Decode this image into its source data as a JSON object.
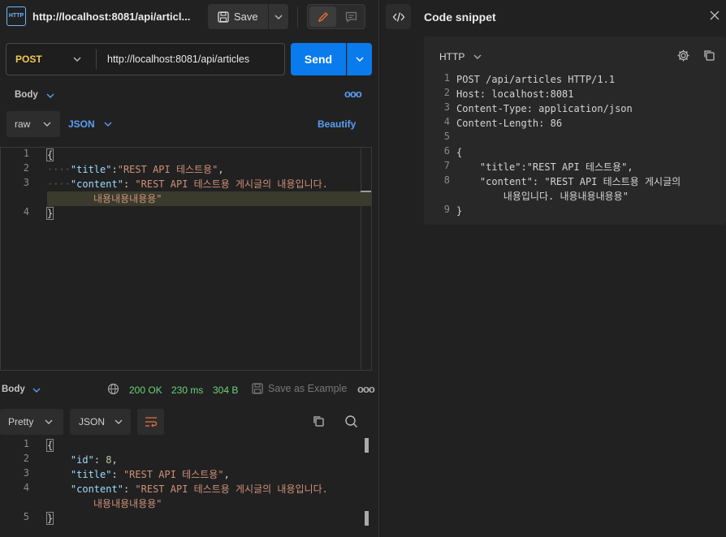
{
  "request": {
    "tab_icon_label": "HTTP",
    "title": "http://localhost:8081/api/articl...",
    "save_label": "Save",
    "method": "POST",
    "url": "http://localhost:8081/api/articles",
    "send_label": "Send"
  },
  "body_panel": {
    "section_label": "Body",
    "mode": "raw",
    "language": "JSON",
    "beautify_label": "Beautify",
    "line_numbers": [
      "1",
      "2",
      "3",
      "4"
    ],
    "lines": {
      "l1": "{",
      "l2_key": "\"title\"",
      "l2_sep": ":",
      "l2_val": "\"REST API 테스트용\"",
      "l2_end": ",",
      "l3_key": "\"content\"",
      "l3_sep": ": ",
      "l3_val_a": "\"REST API 테스트용 게시글의 내용입니다.",
      "l3_val_b": "내용내용내용용\"",
      "l4": "}"
    }
  },
  "response": {
    "section_label": "Body",
    "status": "200 OK",
    "time": "230 ms",
    "size": "304 B",
    "save_example_label": "Save as Example",
    "view_mode": "Pretty",
    "language": "JSON",
    "line_numbers": [
      "1",
      "2",
      "3",
      "4",
      "5"
    ],
    "lines": {
      "l1": "{",
      "l2_key": "\"id\"",
      "l2_sep": ": ",
      "l2_val": "8",
      "l2_end": ",",
      "l3_key": "\"title\"",
      "l3_sep": ": ",
      "l3_val": "\"REST API 테스트용\"",
      "l3_end": ",",
      "l4_key": "\"content\"",
      "l4_sep": ": ",
      "l4_val_a": "\"REST API 테스트용 게시글의 내용입니다.",
      "l4_val_b": "내용내용내용용\"",
      "l5": "}"
    }
  },
  "snippet": {
    "panel_title": "Code snippet",
    "language": "HTTP",
    "line_numbers": [
      "1",
      "2",
      "3",
      "4",
      "5",
      "6",
      "7",
      "8",
      "9"
    ],
    "lines": {
      "l1": "POST /api/articles HTTP/1.1",
      "l2": "Host: localhost:8081",
      "l3": "Content-Type: application/json",
      "l4": "Content-Length: 86",
      "l6": "{",
      "l7": "    \"title\":\"REST API 테스트용\",",
      "l8a": "    \"content\": \"REST API 테스트용 게시글의",
      "l8b": "        내용입니다. 내용내용내용용\"",
      "l9": "}"
    }
  },
  "colors": {
    "accent": "#097bed",
    "method": "#f3c94d",
    "status_ok": "#6ad37a",
    "link_blue": "#5a9ef5"
  }
}
